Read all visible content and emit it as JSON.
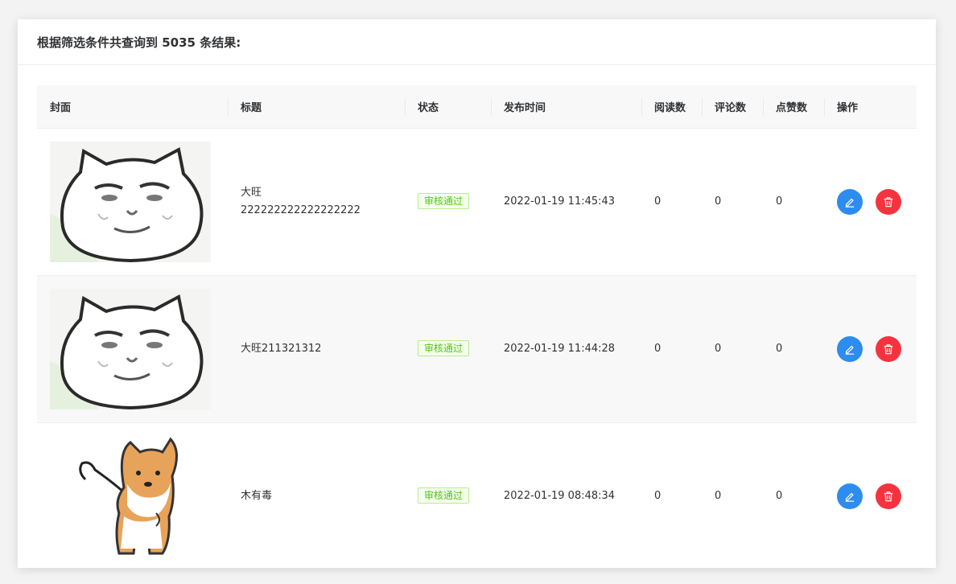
{
  "header": {
    "result_text": "根据筛选条件共查询到 5035 条结果:"
  },
  "columns": [
    "封面",
    "标题",
    "状态",
    "发布时间",
    "阅读数",
    "评论数",
    "点赞数",
    "操作"
  ],
  "rows": [
    {
      "cover_icon": "cat-face-meme-image",
      "title_line1": "大旺",
      "title_line2": "222222222222222222",
      "status": "审核通过",
      "publish_time": "2022-01-19 11:45:43",
      "reads": "0",
      "comments": "0",
      "likes": "0"
    },
    {
      "cover_icon": "cat-face-meme-image",
      "title_line1": "大旺211321312",
      "title_line2": "",
      "status": "审核通过",
      "publish_time": "2022-01-19 11:44:28",
      "reads": "0",
      "comments": "0",
      "likes": "0"
    },
    {
      "cover_icon": "shiba-dog-image",
      "title_line1": "木有毒",
      "title_line2": "",
      "status": "审核通过",
      "publish_time": "2022-01-19 08:48:34",
      "reads": "0",
      "comments": "0",
      "likes": "0"
    }
  ],
  "colors": {
    "edit_button": "#2d8cf0",
    "delete_button": "#f5333f",
    "status_tag_text": "#52c41a"
  }
}
